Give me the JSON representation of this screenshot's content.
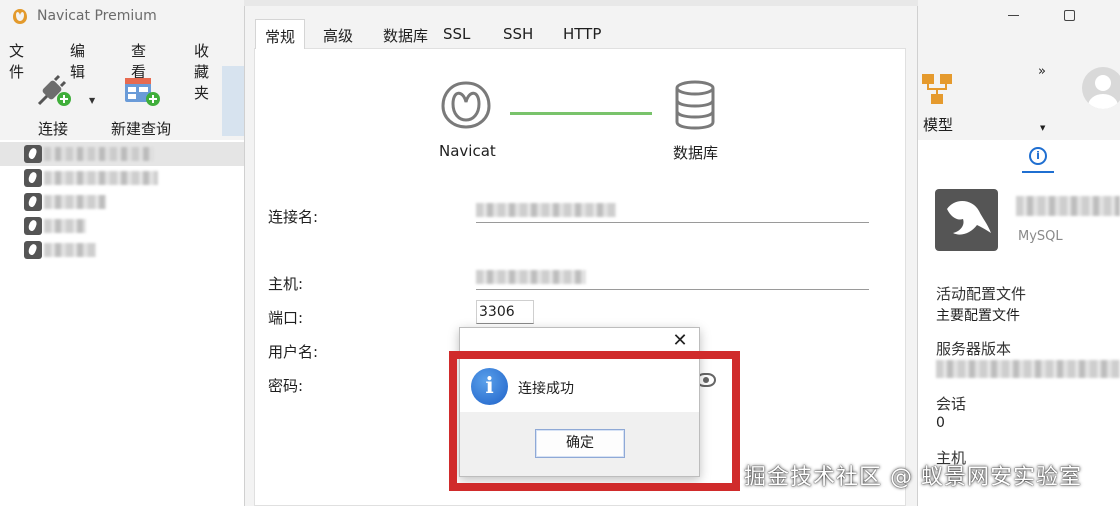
{
  "app": {
    "title": "Navicat Premium"
  },
  "menu": {
    "items": [
      "文件",
      "编辑",
      "查看",
      "收藏夹"
    ]
  },
  "toolbar": {
    "connect_label": "连接",
    "new_query_label": "新建查询",
    "model_label": "模型",
    "more_glyph": "»"
  },
  "connection_dialog": {
    "tabs": [
      "常规",
      "高级",
      "数据库",
      "SSL",
      "SSH",
      "HTTP"
    ],
    "active_tab": "常规",
    "navicat_caption": "Navicat",
    "database_caption": "数据库",
    "form": {
      "connection_name_label": "连接名:",
      "host_label": "主机:",
      "port_label": "端口:",
      "port_value": "3306",
      "username_label": "用户名:",
      "password_label": "密码:"
    }
  },
  "message_box": {
    "text": "连接成功",
    "ok_label": "确定",
    "close_glyph": "✕",
    "info_glyph": "i"
  },
  "right_panel": {
    "server_type": "MySQL",
    "active_profile_label": "活动配置文件",
    "active_profile_value": "主要配置文件",
    "server_version_label": "服务器版本",
    "sessions_label": "会话",
    "sessions_value": "0",
    "host_label": "主机"
  },
  "watermark": {
    "text": "掘金技术社区 @ 蚁景网安实验室"
  },
  "colors": {
    "highlight": "#d02b2b",
    "accent": "#1f6fd1",
    "connection_line": "#79c36b"
  }
}
